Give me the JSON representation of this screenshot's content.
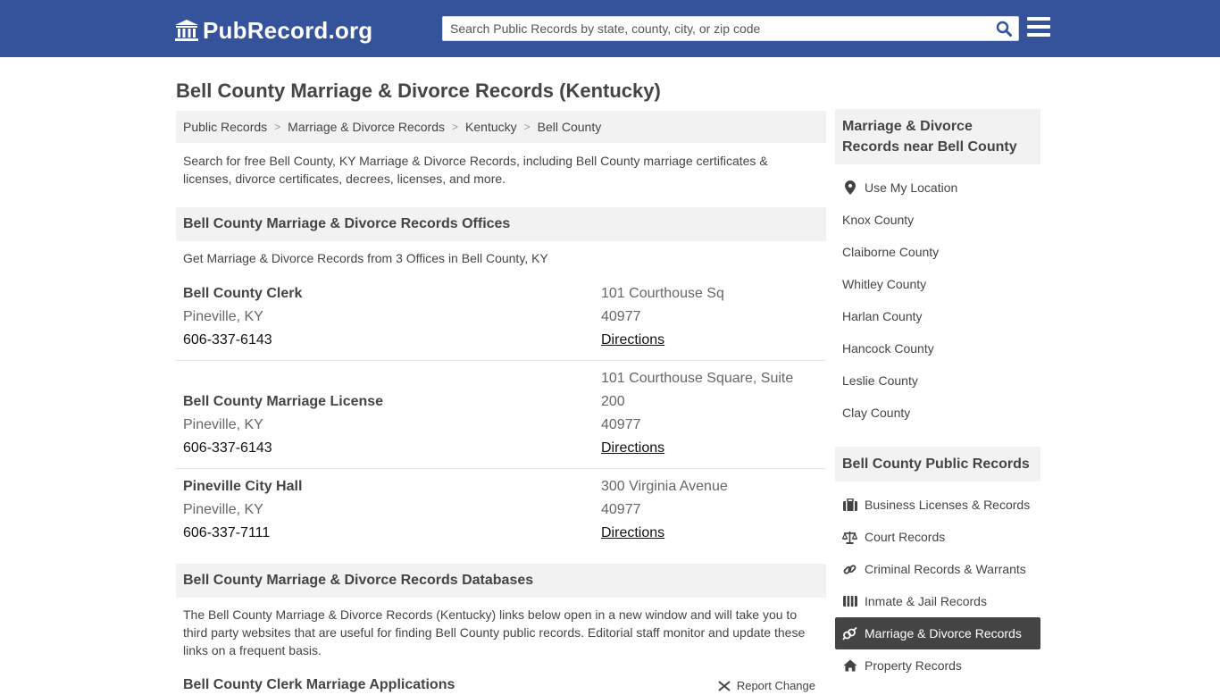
{
  "header": {
    "logo_text": "PubRecord.org",
    "search_placeholder": "Search Public Records by state, county, city, or zip code"
  },
  "page": {
    "title": "Bell County Marriage & Divorce Records (Kentucky)",
    "breadcrumb": [
      "Public Records",
      "Marriage & Divorce Records",
      "Kentucky",
      "Bell County"
    ],
    "intro": "Search for free Bell County, KY Marriage & Divorce Records, including Bell County marriage certificates & licenses, divorce certificates, decrees, licenses, and more."
  },
  "offices": {
    "heading": "Bell County Marriage & Divorce Records Offices",
    "subtitle": "Get Marriage & Divorce Records from 3 Offices in Bell County, KY",
    "items": [
      {
        "name": "Bell County Clerk",
        "city": "Pineville, KY",
        "phone": "606-337-6143",
        "address": "101 Courthouse Sq",
        "zip": "40977",
        "directions": "Directions"
      },
      {
        "name": "Bell County Marriage License",
        "city": "Pineville, KY",
        "phone": "606-337-6143",
        "address": "101 Courthouse Square, Suite 200",
        "zip": "40977",
        "directions": "Directions"
      },
      {
        "name": "Pineville City Hall",
        "city": "Pineville, KY",
        "phone": "606-337-7111",
        "address": "300 Virginia Avenue",
        "zip": "40977",
        "directions": "Directions"
      }
    ]
  },
  "databases": {
    "heading": "Bell County Marriage & Divorce Records Databases",
    "text": "The Bell County Marriage & Divorce Records (Kentucky) links below open in a new window and will take you to third party websites that are useful for finding Bell County public records. Editorial staff monitor and update these links on a frequent basis.",
    "first_item": "Bell County Clerk Marriage Applications",
    "report_change": "Report Change"
  },
  "sidebar": {
    "nearby_heading": "Marriage & Divorce Records near Bell County",
    "use_location": "Use My Location",
    "counties": [
      "Knox County",
      "Claiborne County",
      "Whitley County",
      "Harlan County",
      "Hancock County",
      "Leslie County",
      "Clay County"
    ],
    "public_heading": "Bell County Public Records",
    "categories": [
      {
        "label": "Business Licenses & Records",
        "icon": "briefcase-icon"
      },
      {
        "label": "Court Records",
        "icon": "scales-icon"
      },
      {
        "label": "Criminal Records & Warrants",
        "icon": "link-icon"
      },
      {
        "label": "Inmate & Jail Records",
        "icon": "id-card-icon"
      },
      {
        "label": "Marriage & Divorce Records",
        "icon": "gender-rings-icon",
        "active": true
      },
      {
        "label": "Property Records",
        "icon": "home-icon"
      }
    ]
  },
  "colors": {
    "header_bg": "#34539b",
    "section_bg": "#f2f2f2",
    "active_bg": "#444444"
  }
}
